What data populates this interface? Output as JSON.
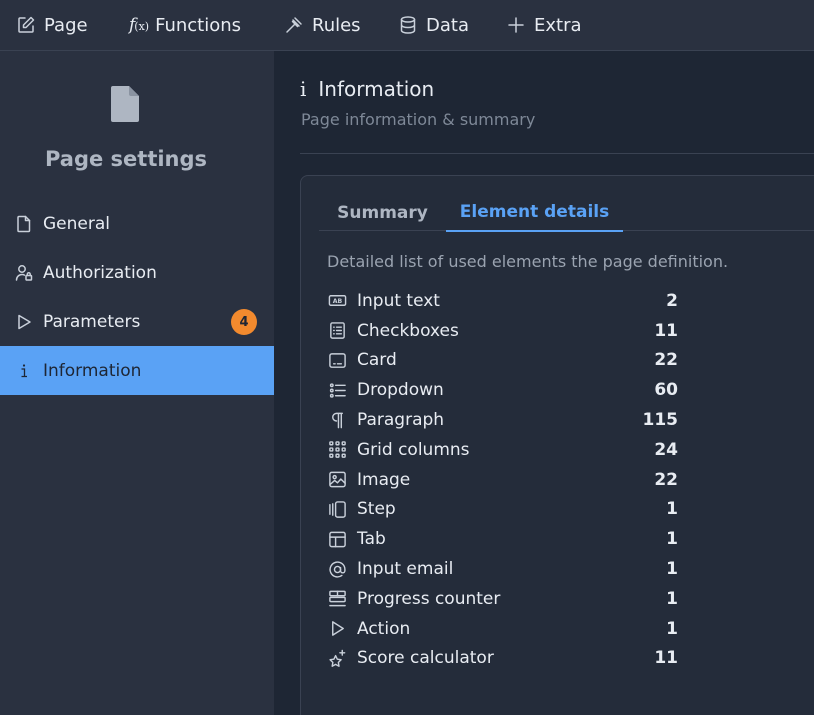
{
  "toolbar": {
    "page": "Page",
    "functions_fx": "f",
    "functions_fx_sub": "(x)",
    "functions": "Functions",
    "rules": "Rules",
    "data": "Data",
    "extra": "Extra"
  },
  "sidebar": {
    "title": "Page settings",
    "items": [
      {
        "label": "General",
        "icon": "file-icon"
      },
      {
        "label": "Authorization",
        "icon": "user-lock-icon"
      },
      {
        "label": "Parameters",
        "icon": "play-icon",
        "badge": "4"
      },
      {
        "label": "Information",
        "icon": "info-icon",
        "active": true
      }
    ]
  },
  "main": {
    "icon": "i",
    "title": "Information",
    "subtitle": "Page information & summary",
    "tabs": [
      {
        "label": "Summary",
        "active": false
      },
      {
        "label": "Element details",
        "active": true
      }
    ],
    "description": "Detailed list of used elements the page definition.",
    "elements": [
      {
        "label": "Input text",
        "count": "2",
        "icon": "input-text-icon"
      },
      {
        "label": "Checkboxes",
        "count": "11",
        "icon": "checklist-icon"
      },
      {
        "label": "Card",
        "count": "22",
        "icon": "card-icon"
      },
      {
        "label": "Dropdown",
        "count": "60",
        "icon": "list-icon"
      },
      {
        "label": "Paragraph",
        "count": "115",
        "icon": "pilcrow-icon"
      },
      {
        "label": "Grid columns",
        "count": "24",
        "icon": "grid-icon"
      },
      {
        "label": "Image",
        "count": "22",
        "icon": "image-icon"
      },
      {
        "label": "Step",
        "count": "1",
        "icon": "step-icon"
      },
      {
        "label": "Tab",
        "count": "1",
        "icon": "tab-icon"
      },
      {
        "label": "Input email",
        "count": "1",
        "icon": "at-icon"
      },
      {
        "label": "Progress counter",
        "count": "1",
        "icon": "progress-icon"
      },
      {
        "label": "Action",
        "count": "1",
        "icon": "play-icon"
      },
      {
        "label": "Score calculator",
        "count": "11",
        "icon": "sparkle-star-icon"
      }
    ]
  },
  "colors": {
    "accent": "#5aa2f5",
    "badge": "#f28a2e",
    "sidebar_bg": "#2a3140",
    "main_bg": "#1e2634"
  }
}
